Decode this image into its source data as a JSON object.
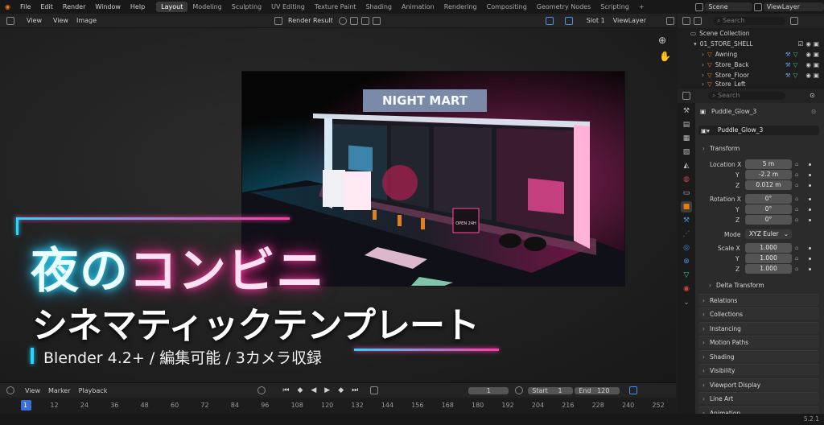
{
  "top_menu": {
    "items": [
      "File",
      "Edit",
      "Render",
      "Window",
      "Help"
    ]
  },
  "workspaces": [
    "Layout",
    "Modeling",
    "Sculpting",
    "UV Editing",
    "Texture Paint",
    "Shading",
    "Animation",
    "Rendering",
    "Compositing",
    "Geometry Nodes",
    "Scripting"
  ],
  "active_workspace": "Layout",
  "add_workspace": "+",
  "scene": {
    "label": "Scene",
    "viewlayer": "ViewLayer"
  },
  "image_editor": {
    "view": "View",
    "view2": "View",
    "image": "Image",
    "render_result": "Render Result",
    "slot": "Slot 1",
    "layer": "ViewLayer"
  },
  "render_scene": {
    "sign": "NIGHT MART",
    "small_sign": "OPEN 24H"
  },
  "promo": {
    "line1a": "夜の",
    "line1b": "コンビニ",
    "line2": "シネマティックテンプレート",
    "sub": "Blender 4.2+ / 編集可能 / 3カメラ収録"
  },
  "timeline": {
    "view": "View",
    "marker": "Marker",
    "playback": "Playback",
    "current_frame": "1",
    "start_label": "Start",
    "start": "1",
    "end_label": "End",
    "end": "120",
    "frames": [
      "1",
      "12",
      "24",
      "36",
      "48",
      "60",
      "72",
      "84",
      "96",
      "108",
      "120",
      "132",
      "144",
      "156",
      "168",
      "180",
      "192",
      "204",
      "216",
      "228",
      "240",
      "252"
    ]
  },
  "outliner": {
    "search_placeholder": "Search",
    "collection": "Scene Collection",
    "items": [
      "01_STORE_SHELL",
      "Awning",
      "Store_Back",
      "Store_Floor",
      "Store_Left"
    ]
  },
  "properties": {
    "search_placeholder": "Search",
    "object_name": "Puddle_Glow_3",
    "object_field": "Puddle_Glow_3",
    "transform": "Transform",
    "location_label": "Location X",
    "location": [
      "5 m",
      "-2.2 m",
      "0.012 m"
    ],
    "rotation_label": "Rotation X",
    "rotation": [
      "0°",
      "0°",
      "0°"
    ],
    "mode_label": "Mode",
    "mode": "XYZ Euler",
    "scale_label": "Scale X",
    "scale": [
      "1.000",
      "1.000",
      "1.000"
    ],
    "y": "Y",
    "z": "Z",
    "panels": [
      "Delta Transform",
      "Relations",
      "Collections",
      "Instancing",
      "Motion Paths",
      "Shading",
      "Visibility",
      "Viewport Display",
      "Line Art",
      "Animation"
    ]
  },
  "status": {
    "version": "5.2.1"
  },
  "colors": {
    "cyan": "#2fe0ff",
    "pink": "#ff3ca5",
    "blender_orange": "#e87d0d"
  }
}
